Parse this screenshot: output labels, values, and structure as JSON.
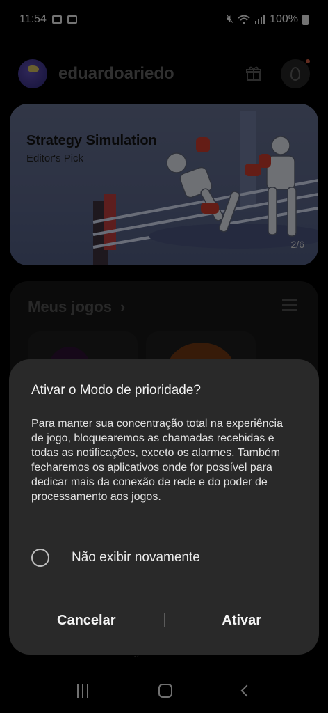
{
  "status_bar": {
    "time": "11:54",
    "battery": "100%"
  },
  "header": {
    "username": "eduardoariedo"
  },
  "banner": {
    "title": "Strategy Simulation",
    "subtitle": "Editor's Pick",
    "pager": "2/6"
  },
  "games": {
    "title": "Meus jogos",
    "chevron": "›"
  },
  "bottom_nav": [
    "Início",
    "Jogos instantâneos",
    "Mais"
  ],
  "dialog": {
    "title": "Ativar o Modo de prioridade?",
    "body": "Para manter sua concentração total na experiência de jogo, bloquearemos as chamadas recebidas e todas as notificações, exceto os alarmes. Também fecharemos os aplicativos onde for possível para dedicar mais da conexão de rede e do poder de processamento aos jogos.",
    "checkbox_label": "Não exibir novamente",
    "checkbox_checked": false,
    "cancel_label": "Cancelar",
    "confirm_label": "Ativar"
  },
  "colors": {
    "dialog_bg": "#292929",
    "background": "#000000",
    "banner_bg": "#5f6a87"
  }
}
